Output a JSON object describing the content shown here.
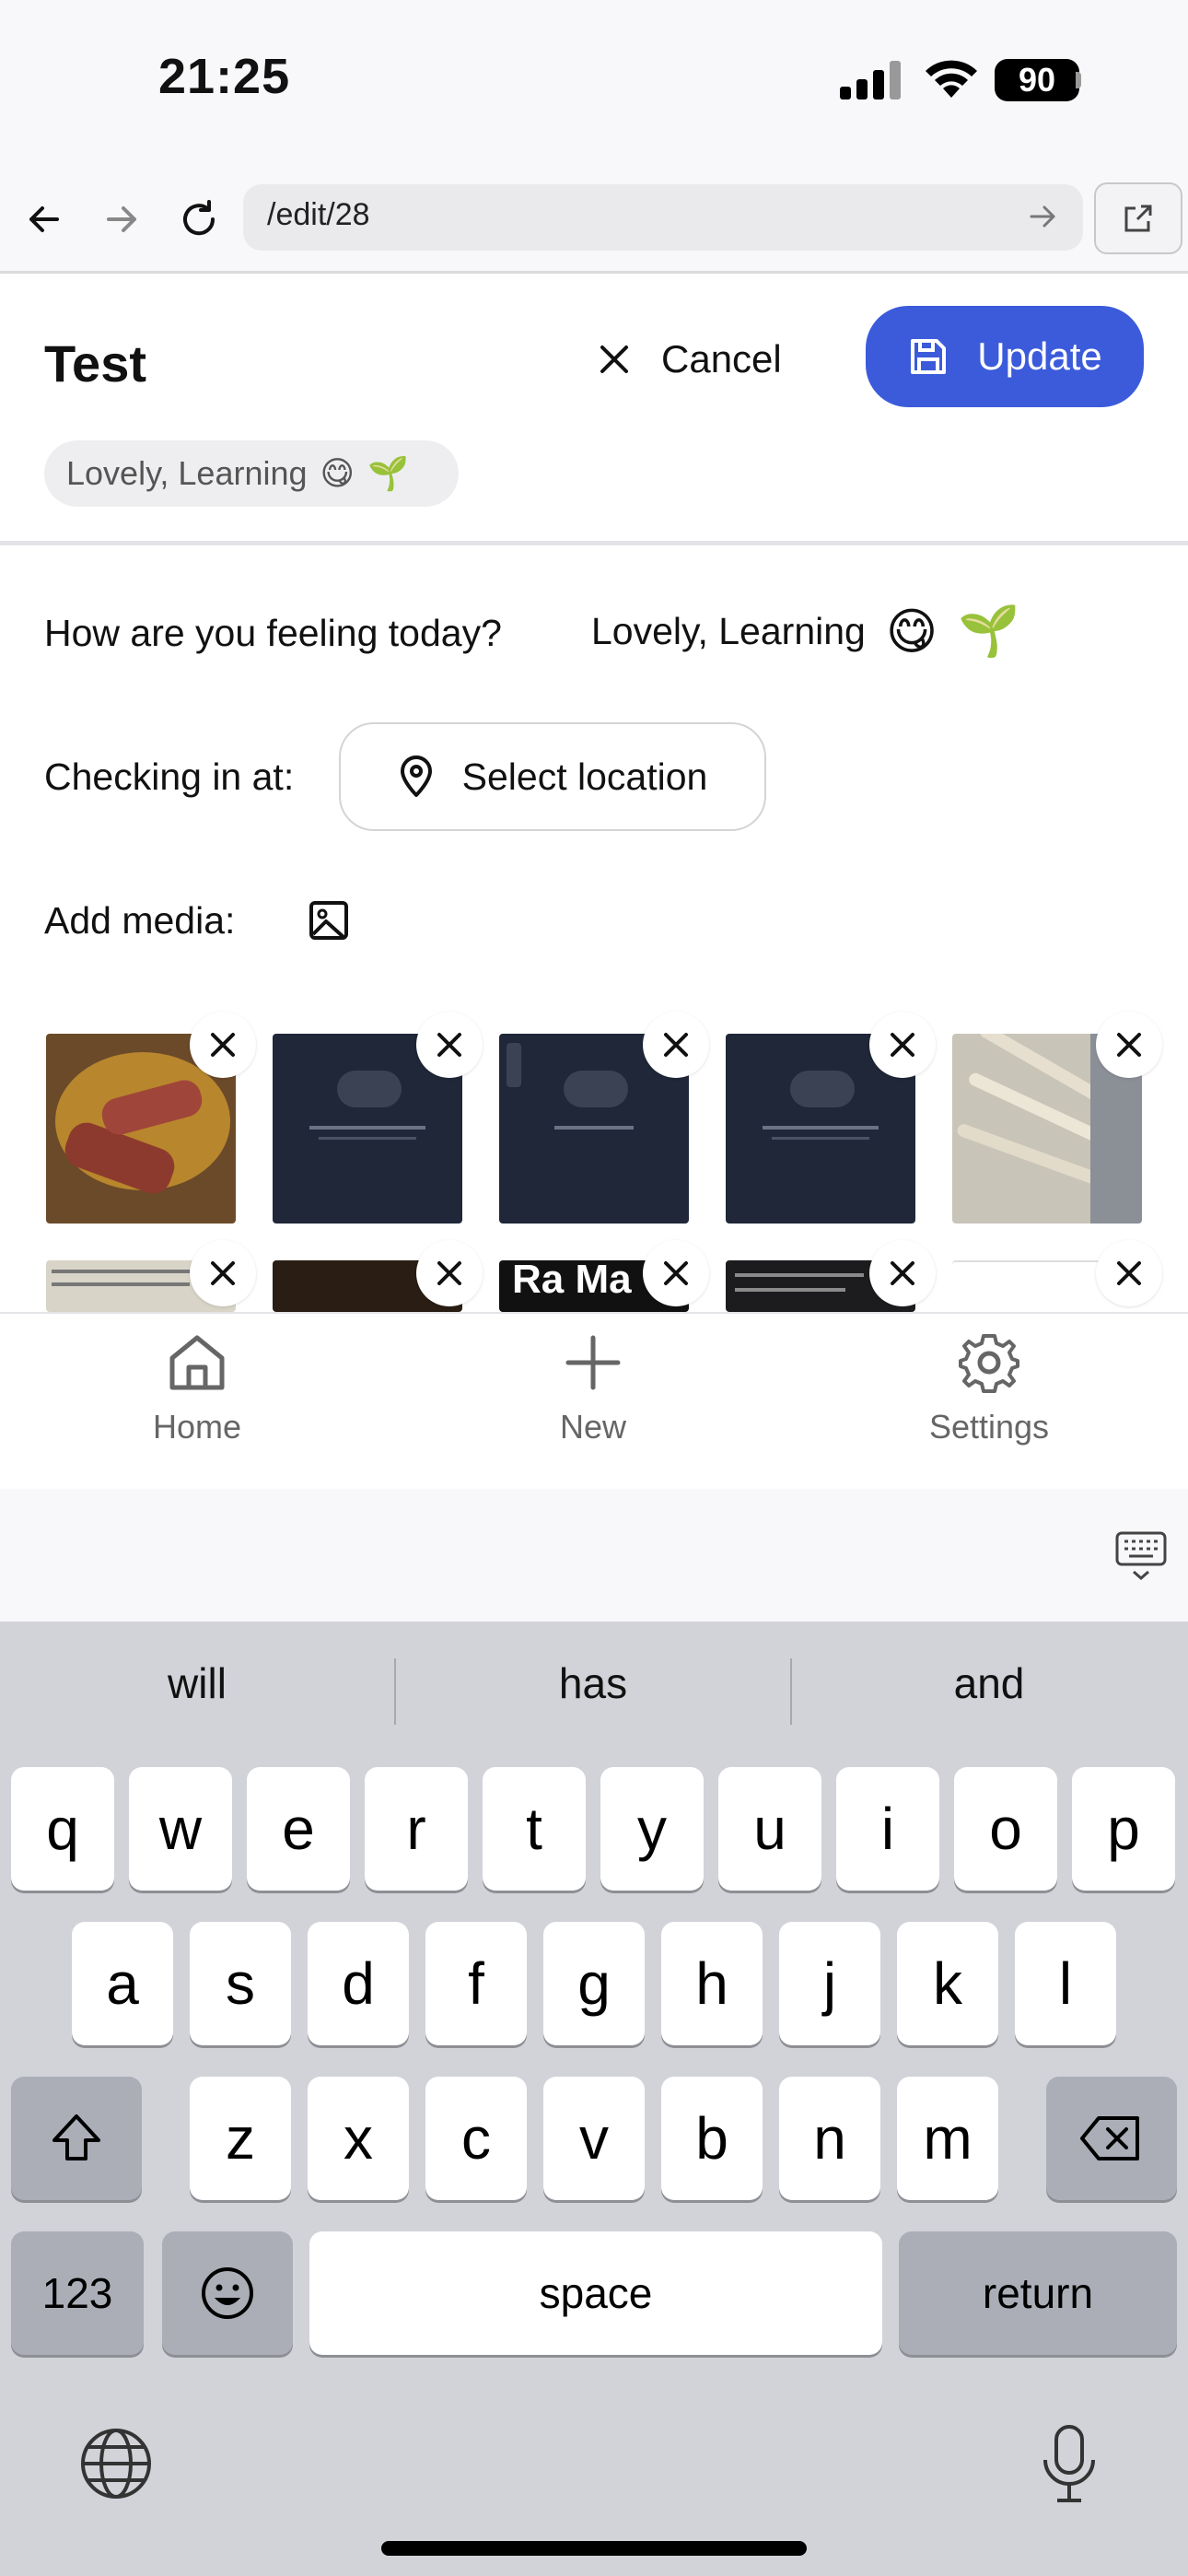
{
  "status_bar": {
    "time": "21:25",
    "battery": "90"
  },
  "browser": {
    "url": "/edit/28"
  },
  "header": {
    "title": "Test",
    "cancel_label": "Cancel",
    "update_label": "Update",
    "mood_chip": "Lovely, Learning",
    "mood_emojis": [
      "😋",
      "🌱"
    ]
  },
  "form": {
    "feeling_label": "How are you feeling today?",
    "feeling_value": "Lovely, Learning",
    "feeling_emojis": [
      "😋",
      "🌱"
    ],
    "checkin_label": "Checking in at:",
    "location_button": "Select location",
    "media_label": "Add media:"
  },
  "media": {
    "row2_text": "Ra Ma"
  },
  "nav": [
    {
      "label": "Home",
      "icon": "home-icon"
    },
    {
      "label": "New",
      "icon": "plus-icon"
    },
    {
      "label": "Settings",
      "icon": "gear-icon"
    }
  ],
  "keyboard": {
    "suggestions": [
      "will",
      "has",
      "and"
    ],
    "row1": [
      "q",
      "w",
      "e",
      "r",
      "t",
      "y",
      "u",
      "i",
      "o",
      "p"
    ],
    "row2": [
      "a",
      "s",
      "d",
      "f",
      "g",
      "h",
      "j",
      "k",
      "l"
    ],
    "row3": [
      "z",
      "x",
      "c",
      "v",
      "b",
      "n",
      "m"
    ],
    "numbers_label": "123",
    "space_label": "space",
    "return_label": "return"
  },
  "colors": {
    "accent": "#3b5bdb",
    "keyboard_bg": "#d2d3d9"
  }
}
